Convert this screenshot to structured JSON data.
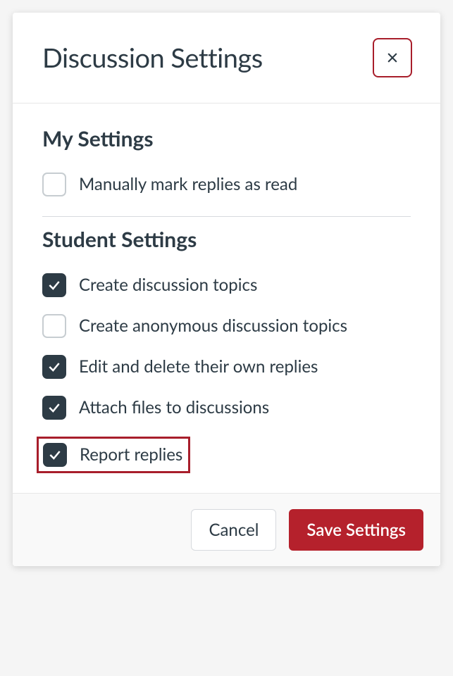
{
  "header": {
    "title": "Discussion Settings"
  },
  "sections": {
    "my_settings": {
      "heading": "My Settings",
      "items": [
        {
          "label": "Manually mark replies as read",
          "checked": false
        }
      ]
    },
    "student_settings": {
      "heading": "Student Settings",
      "items": [
        {
          "label": "Create discussion topics",
          "checked": true
        },
        {
          "label": "Create anonymous discussion topics",
          "checked": false
        },
        {
          "label": "Edit and delete their own replies",
          "checked": true
        },
        {
          "label": "Attach files to discussions",
          "checked": true
        },
        {
          "label": "Report replies",
          "checked": true,
          "highlighted": true
        }
      ]
    }
  },
  "footer": {
    "cancel": "Cancel",
    "save": "Save Settings"
  },
  "colors": {
    "accent": "#b5212c",
    "text": "#2d3b45"
  }
}
